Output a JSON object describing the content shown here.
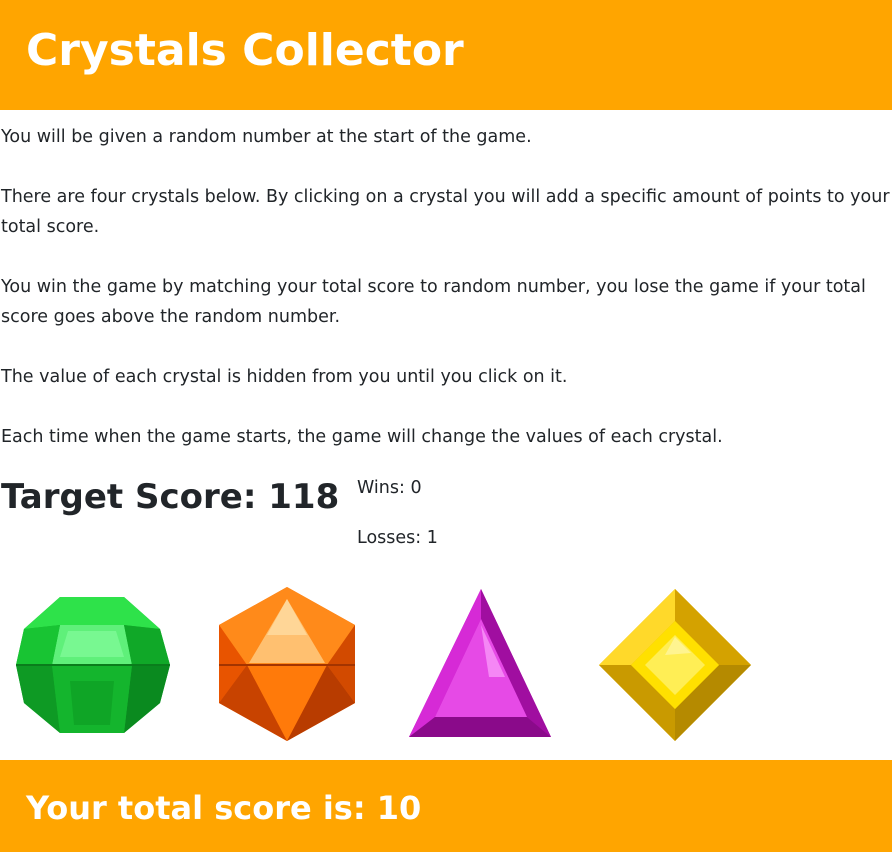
{
  "header": {
    "title": "Crystals Collector"
  },
  "instructions": [
    "You will be given a random number at the start of the game.",
    "There are four crystals below. By clicking on a crystal you will add a specific amount of points to your total score.",
    "You win the game by matching your total score to random number, you lose the game if your total score goes above the random number.",
    "The value of each crystal is hidden from you until you click on it.",
    "Each time when the game starts, the game will change the values of each crystal."
  ],
  "target": {
    "label": "Target Score: 118"
  },
  "stats": {
    "wins": "Wins: 0",
    "losses": "Losses: 1"
  },
  "crystals": [
    {
      "name": "green-crystal",
      "color": "#22c93a"
    },
    {
      "name": "orange-crystal",
      "color": "#ff6a00"
    },
    {
      "name": "purple-crystal",
      "color": "#d41bd4"
    },
    {
      "name": "yellow-crystal",
      "color": "#ffd600"
    }
  ],
  "footer": {
    "score_text": "Your total score is: 10"
  },
  "colors": {
    "accent": "#ffa500"
  }
}
